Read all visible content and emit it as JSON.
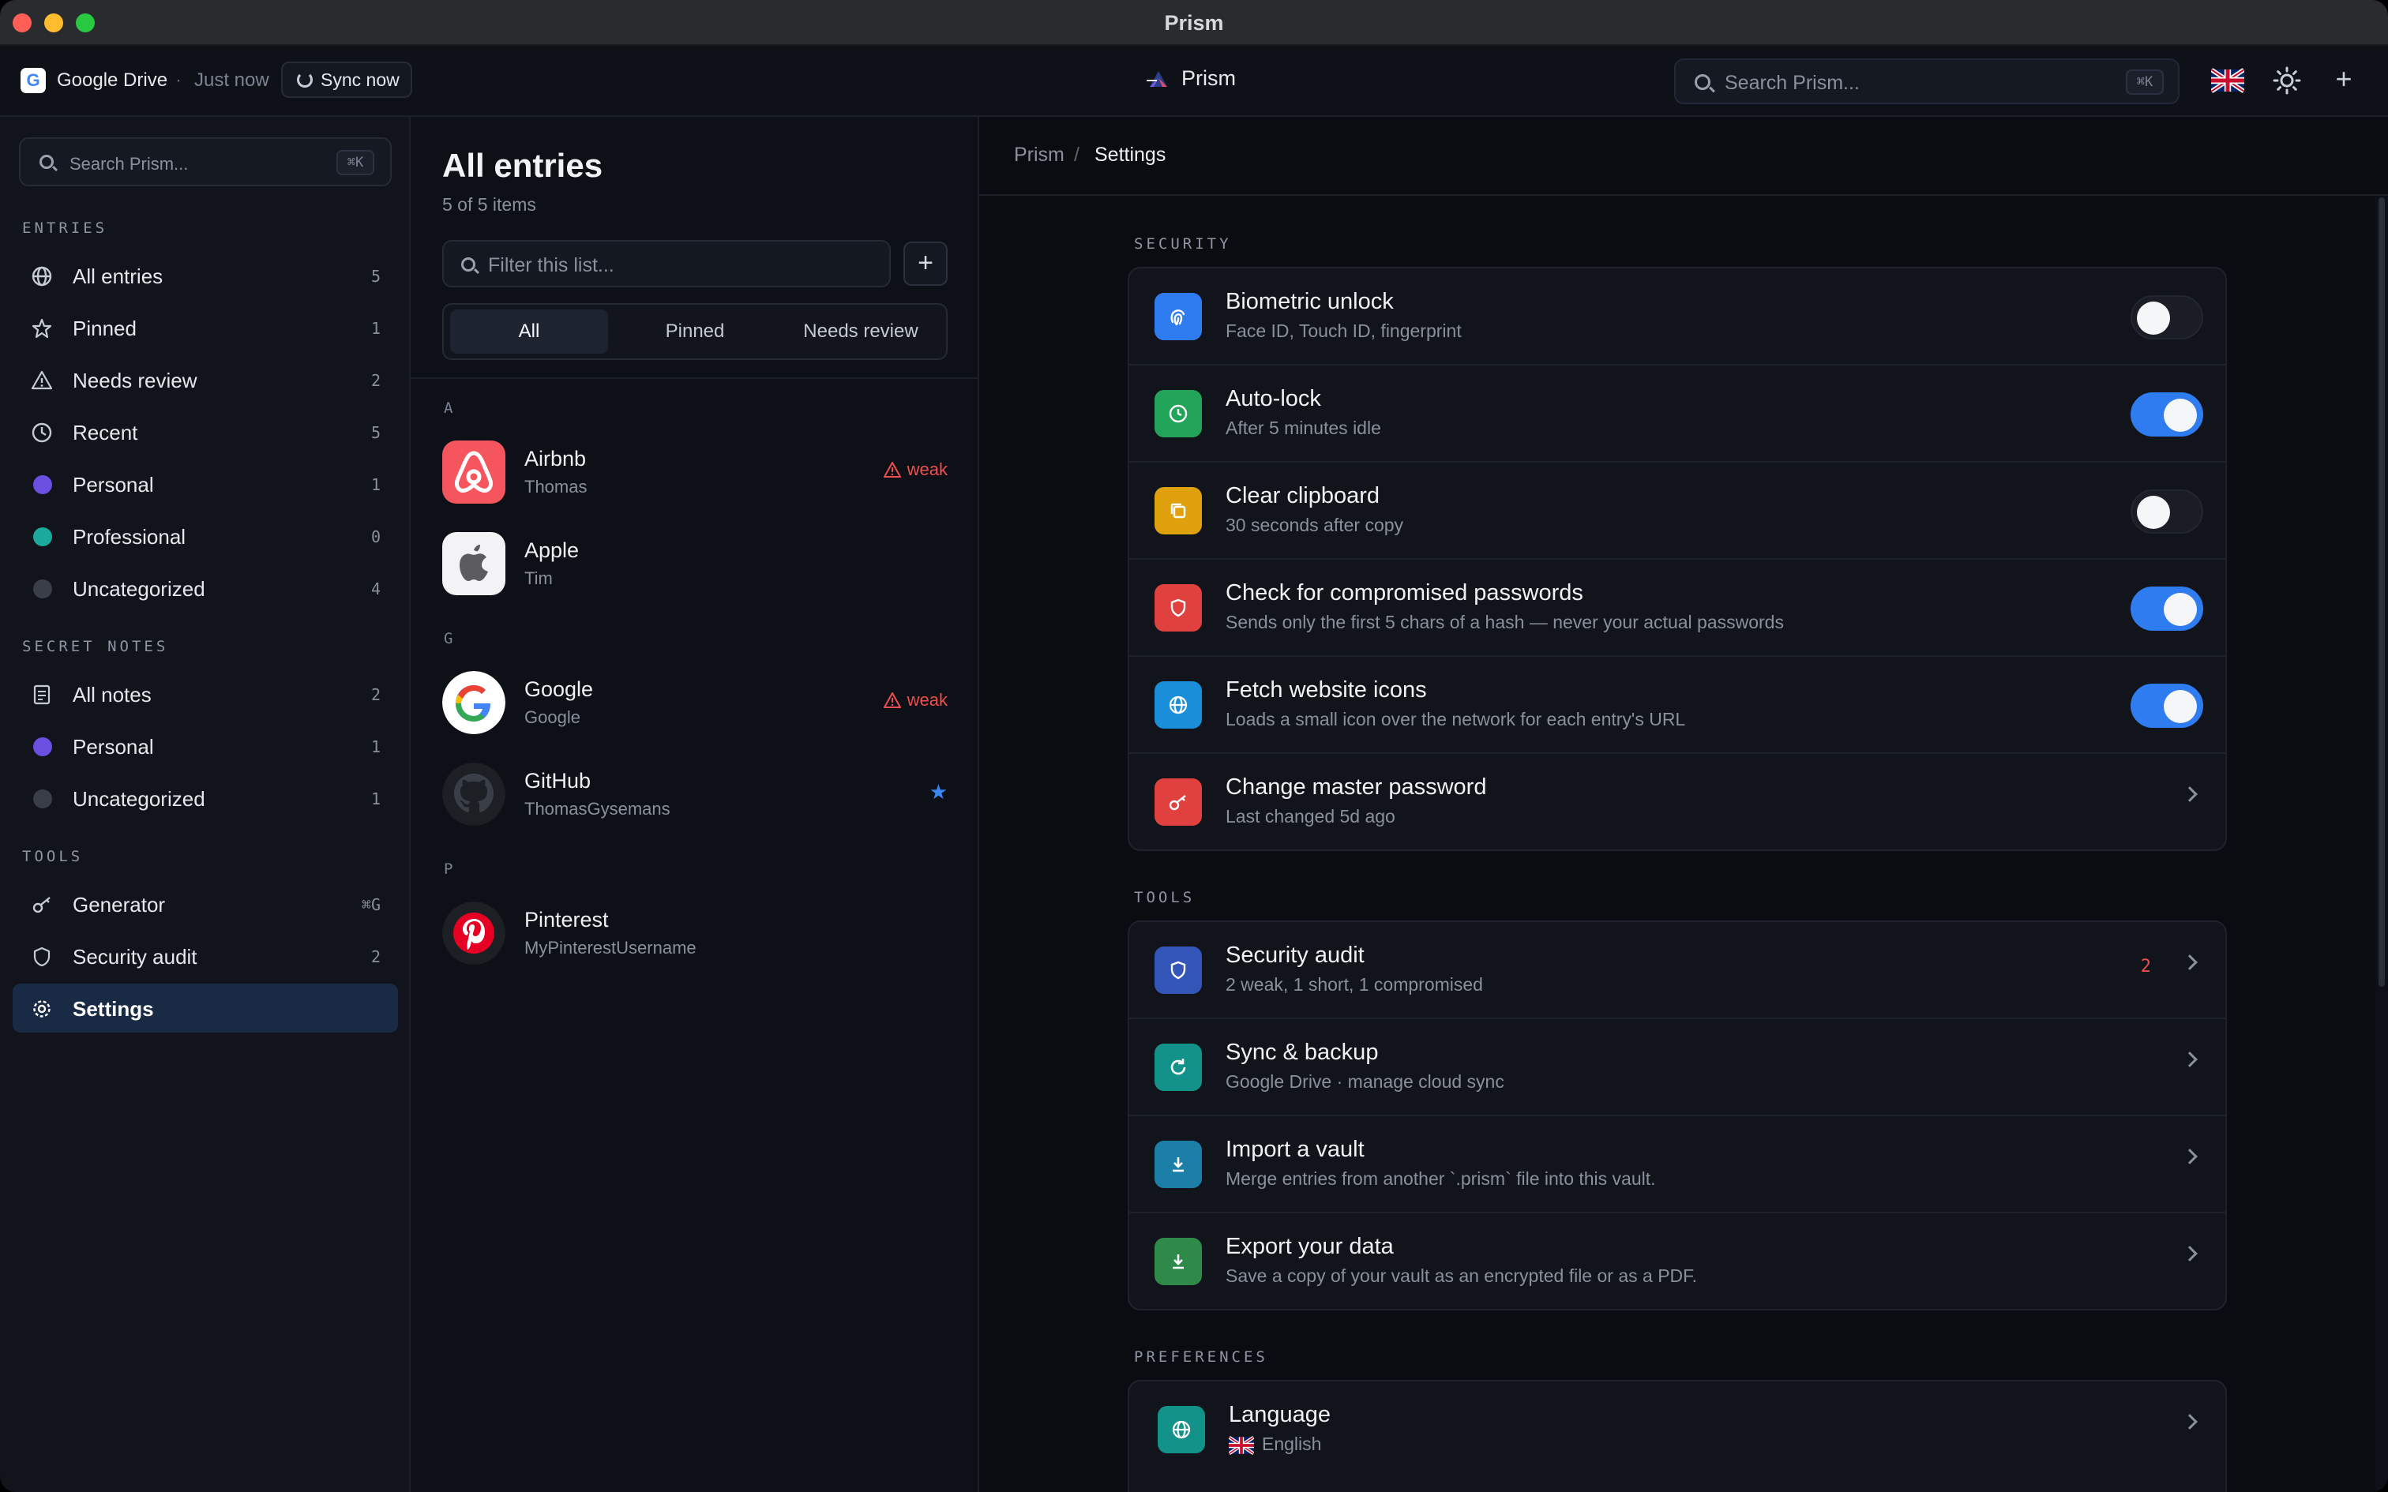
{
  "window": {
    "title": "Prism"
  },
  "header": {
    "provider": "Google Drive",
    "separator": "·",
    "sync_time": "Just now",
    "sync_button": "Sync now",
    "brand": "Prism",
    "search_placeholder": "Search Prism...",
    "search_shortcut": "⌘K",
    "language_flag": "uk-flag-icon",
    "theme_icon": "sun-icon",
    "add_label": "+"
  },
  "sidebar": {
    "search_placeholder": "Search Prism...",
    "search_shortcut": "⌘K",
    "entries_label": "ENTRIES",
    "entries": [
      {
        "label": "All entries",
        "count": "5",
        "icon": "globe-icon"
      },
      {
        "label": "Pinned",
        "count": "1",
        "icon": "star-icon"
      },
      {
        "label": "Needs review",
        "count": "2",
        "icon": "warning-icon"
      },
      {
        "label": "Recent",
        "count": "5",
        "icon": "clock-icon"
      },
      {
        "label": "Personal",
        "count": "1",
        "color": "#6b4fe0"
      },
      {
        "label": "Professional",
        "count": "0",
        "color": "#1aa99c"
      },
      {
        "label": "Uncategorized",
        "count": "4",
        "color": "#3a3e48"
      }
    ],
    "notes_label": "SECRET NOTES",
    "notes": [
      {
        "label": "All notes",
        "count": "2",
        "icon": "note-icon"
      },
      {
        "label": "Personal",
        "count": "1",
        "color": "#6b4fe0"
      },
      {
        "label": "Uncategorized",
        "count": "1",
        "color": "#3a3e48"
      }
    ],
    "tools_label": "TOOLS",
    "tools": [
      {
        "label": "Generator",
        "count": "⌘G",
        "icon": "key-icon"
      },
      {
        "label": "Security audit",
        "count": "2",
        "icon": "shield-icon"
      },
      {
        "label": "Settings",
        "count": "",
        "icon": "gear-icon",
        "active": true
      }
    ]
  },
  "list": {
    "title": "All entries",
    "subtitle": "5 of 5 items",
    "filter_placeholder": "Filter this list...",
    "add_label": "+",
    "segments": [
      "All",
      "Pinned",
      "Needs review"
    ],
    "groups": [
      {
        "letter": "A",
        "entries": [
          {
            "name": "Airbnb",
            "user": "Thomas",
            "badge": "weak"
          },
          {
            "name": "Apple",
            "user": "Tim",
            "badge": ""
          }
        ]
      },
      {
        "letter": "G",
        "entries": [
          {
            "name": "Google",
            "user": "Google",
            "badge": "weak"
          },
          {
            "name": "GitHub",
            "user": "ThomasGysemans",
            "badge": "",
            "pinned": true
          }
        ]
      },
      {
        "letter": "P",
        "entries": [
          {
            "name": "Pinterest",
            "user": "MyPinterestUsername",
            "badge": ""
          }
        ]
      }
    ]
  },
  "main": {
    "breadcrumb": [
      "Prism",
      "/",
      "Settings"
    ],
    "security_label": "SECURITY",
    "security": [
      {
        "title": "Biometric unlock",
        "sub": "Face ID, Touch ID, fingerprint",
        "toggle": false,
        "color": "#2f7cf0",
        "icon": "fingerprint-icon"
      },
      {
        "title": "Auto-lock",
        "sub": "After 5 minutes idle",
        "toggle": true,
        "color": "#22a55a",
        "icon": "clock-icon"
      },
      {
        "title": "Clear clipboard",
        "sub": "30 seconds after copy",
        "toggle": false,
        "color": "#e0a10f",
        "icon": "copy-icon"
      },
      {
        "title": "Check for compromised passwords",
        "sub": "Sends only the first 5 chars of a hash — never your actual passwords",
        "toggle": true,
        "color": "#e0413f",
        "icon": "shield-icon"
      },
      {
        "title": "Fetch website icons",
        "sub": "Loads a small icon over the network for each entry's URL",
        "toggle": true,
        "color": "#1a8ed8",
        "icon": "globe-icon"
      },
      {
        "title": "Change master password",
        "sub": "Last changed 5d ago",
        "toggle": null,
        "color": "#e0413f",
        "icon": "key-icon"
      }
    ],
    "tools_label": "TOOLS",
    "tools": [
      {
        "title": "Security audit",
        "sub": "2 weak, 1 short, 1 compromised",
        "count": "2",
        "color": "#3456b8",
        "icon": "shield-icon"
      },
      {
        "title": "Sync & backup",
        "sub": "Google Drive · manage cloud sync",
        "count": "",
        "color": "#13928a",
        "icon": "refresh-icon"
      },
      {
        "title": "Import a vault",
        "sub": "Merge entries from another `.prism` file into this vault.",
        "count": "",
        "color": "#1c7fa8",
        "icon": "download-icon"
      },
      {
        "title": "Export your data",
        "sub": "Save a copy of your vault as an encrypted file or as a PDF.",
        "count": "",
        "color": "#2f8a4a",
        "icon": "download-icon"
      }
    ],
    "preferences_label": "PREFERENCES",
    "preferences": [
      {
        "title": "Language",
        "sub": "English",
        "color": "#13928a",
        "icon": "globe-icon",
        "flag": "uk-flag-icon"
      }
    ]
  }
}
